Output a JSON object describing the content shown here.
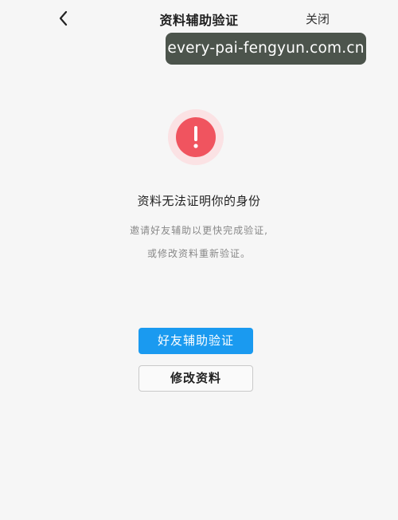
{
  "nav": {
    "back_icon": "chevron-left-icon",
    "title": "资料辅助验证",
    "close_label": "关闭"
  },
  "watermark": {
    "text": "every-pai-fengyun.com.cn"
  },
  "alert": {
    "icon": "exclamation-icon",
    "glyph": "!",
    "color": "#f0545f",
    "halo_color": "#fbe2e4"
  },
  "message": {
    "headline": "资料无法证明你的身份",
    "description_line1": "邀请好友辅助以更快完成验证,",
    "description_line2": "或修改资料重新验证。"
  },
  "actions": {
    "primary_label": "好友辅助验证",
    "primary_color": "#1a9af0",
    "secondary_label": "修改资料"
  }
}
